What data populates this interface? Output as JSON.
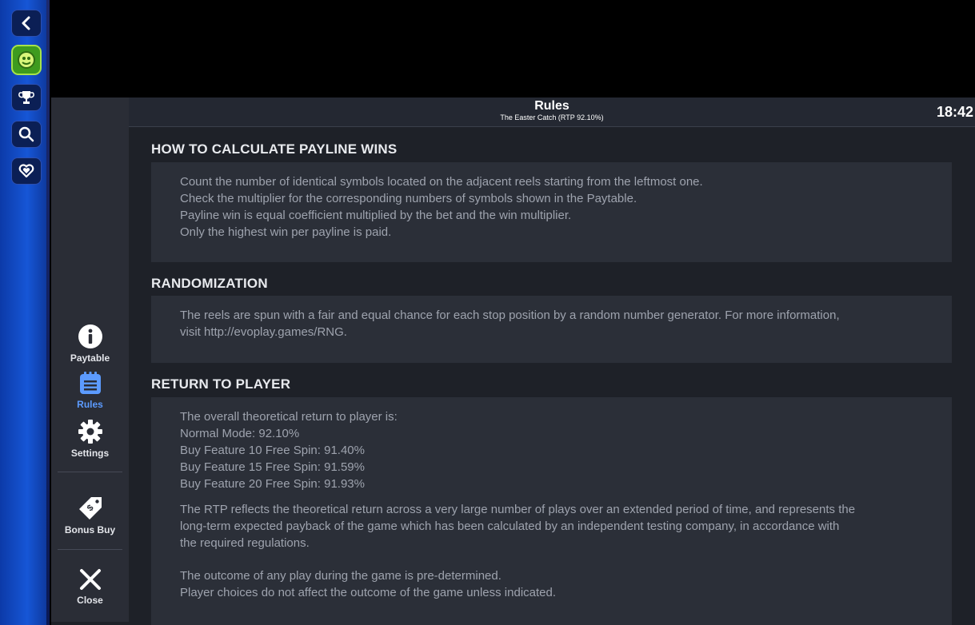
{
  "launcher": {
    "buttons": [
      {
        "icon": "back-arrow-icon"
      },
      {
        "icon": "game-avatar-icon"
      },
      {
        "icon": "trophy-icon"
      },
      {
        "icon": "search-icon"
      },
      {
        "icon": "heart-icon"
      }
    ]
  },
  "header": {
    "title": "Rules",
    "subtitle": "The Easter Catch (RTP 92.10%)",
    "clock": "18:42"
  },
  "sidebar": {
    "items": [
      {
        "label": "Paytable",
        "icon": "info-icon"
      },
      {
        "label": "Rules",
        "icon": "rules-icon",
        "active": true
      },
      {
        "label": "Settings",
        "icon": "gear-icon"
      },
      {
        "label": "Bonus Buy",
        "icon": "tag-icon"
      },
      {
        "label": "Close",
        "icon": "close-icon"
      }
    ],
    "active_color": "#5c9bff"
  },
  "sections": [
    {
      "heading": "HOW TO CALCULATE PAYLINE WINS",
      "lines": [
        "Count the number of identical symbols located on the adjacent reels starting from the leftmost one.",
        "Check the multiplier for the corresponding numbers of symbols shown in the Paytable.",
        "Payline win is equal coefficient multiplied by the bet and the win multiplier.",
        "Only the highest win per payline is paid."
      ]
    },
    {
      "heading": "RANDOMIZATION",
      "lines": [
        "The reels are spun with a fair and equal chance for each stop position by a random number generator. For more information,",
        "visit http://evoplay.games/RNG."
      ]
    },
    {
      "heading": "RETURN TO PLAYER",
      "lines": [
        "The overall theoretical return to player is:",
        "Normal Mode: 92.10%",
        "Buy Feature 10 Free Spin: 91.40%",
        "Buy Feature 15 Free Spin: 91.59%",
        "Buy Feature 20 Free Spin: 91.93%"
      ],
      "paragraph": [
        "The RTP reflects the theoretical return across a very large number of plays over an extended period of time, and represents the",
        "long-term expected payback of the game which has been calculated by an independent testing company, in accordance with",
        "the required regulations."
      ],
      "footer": [
        "The outcome of any play during the game is pre-determined.",
        "Player choices do not affect the outcome of the game unless indicated."
      ]
    }
  ]
}
